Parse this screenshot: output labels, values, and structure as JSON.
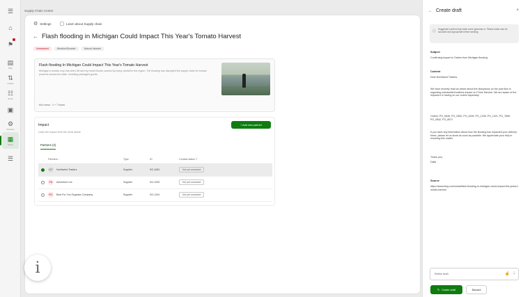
{
  "app": {
    "title": "Supply Chain Center"
  },
  "rail": [
    {
      "name": "menu",
      "glyph": "☰",
      "label": ""
    },
    {
      "name": "home",
      "glyph": "⌂",
      "label": ""
    },
    {
      "name": "alerts",
      "glyph": "⚑",
      "label": ""
    },
    {
      "name": "planning",
      "glyph": "▤",
      "label": "Plan"
    },
    {
      "name": "orders",
      "glyph": "⇅",
      "label": "Orders"
    },
    {
      "name": "inventory",
      "glyph": "☷",
      "label": "Stock"
    },
    {
      "name": "chat",
      "glyph": "▣",
      "label": ""
    },
    {
      "name": "insights",
      "glyph": "⚙",
      "label": "Partners"
    },
    {
      "name": "news",
      "glyph": "▦",
      "label": "News"
    },
    {
      "name": "settings",
      "glyph": "☰",
      "label": ""
    }
  ],
  "toolbar": {
    "settings": "Settings",
    "learn": "Learn about Supply chain"
  },
  "article": {
    "title": "Flash flooding in Michigan Could Impact This Year's Tomato Harvest",
    "tags": [
      "Unresolved",
      "Weather/Disaster",
      "Natural disaster"
    ],
    "card_title": "Flash flooding In Michigan Could Impact This Year's Tomato Harvest",
    "card_body": "Michigan's tomato crop has been hit hard by recent floods caused by heavy rainfall in the region. The flooding has disrupted the supply chain for tomato products across the state, including packaged goods.",
    "card_meta": "Kiro news · 1 + 7 hours"
  },
  "impact": {
    "title": "Impact",
    "subtitle": "Learn the impact from the news article",
    "add_button": "+ Add new partner",
    "tab": "Partners (3)",
    "columns": [
      "Partners ↑",
      "Type",
      "ID",
      "Contact status ▽"
    ],
    "rows": [
      {
        "initials": "NT",
        "name": "Northwind Traders",
        "type": "Supplier",
        "id": "SO-1081",
        "status": "Not yet contacted",
        "selected": true
      },
      {
        "initials": "FA",
        "name": "Adventure Ltd.",
        "type": "Supplier",
        "id": "SO-1092",
        "status": "Not yet contacted",
        "selected": false
      },
      {
        "initials": "RC",
        "name": "Best For You Organics Company",
        "type": "Supplier",
        "id": "SO-1104",
        "status": "Not yet contacted",
        "selected": false
      }
    ]
  },
  "panel": {
    "title": "Create draft",
    "warning": "Suggested content may make some grammar or. Please make sure its accurate and appropriate before sending.",
    "subject_label": "Subject",
    "subject": "Confirming impact to Orders from Michigan flooding",
    "content_label": "Content",
    "content": [
      "Dear Northwind Traders,",
      "We have recently read an article about the disruptions on the post flow in regarding substantial foodlines impact on Prime Harvest. We are aware of the impacts it is having on our orders especially:",
      "Orders: PO_0646, PO_0462, PO_4499, PO_1208, PO_1421, PO_7655, PO_0842, PO_8571",
      "If you have any information about how the flooding has impacted your delivery times, please let us know as soon as possible. We appreciate your help in resolving this matter.",
      "Thank you,",
      "Dalia"
    ],
    "source_label": "Source",
    "source": "https://www.bing.com/news/flash-flooding-in-michigan-could-impact-this-years-tomato-harvest",
    "refine_placeholder": "Refine draft",
    "create_button": "Create draft",
    "discard_button": "Discard"
  },
  "colors": {
    "accent": "#107c10",
    "alert": "#c50f1f"
  }
}
